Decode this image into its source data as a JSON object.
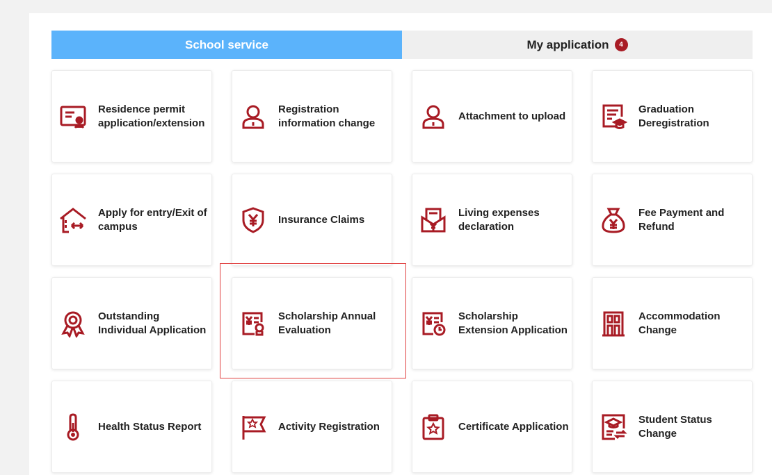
{
  "tabs": {
    "school_service": "School service",
    "my_application": "My application",
    "my_application_badge": "4"
  },
  "colors": {
    "accent": "#5bb3fb",
    "icon": "#a81b24",
    "highlight_border": "#e0403f"
  },
  "services": [
    {
      "label": "Residence permit application/extension",
      "icon": "id-card-icon"
    },
    {
      "label": "Registration information change",
      "icon": "user-icon"
    },
    {
      "label": "Attachment to upload",
      "icon": "user-upload-icon"
    },
    {
      "label": "Graduation Deregistration",
      "icon": "graduation-document-icon"
    },
    {
      "label": "Apply for entry/Exit of campus",
      "icon": "campus-gate-icon"
    },
    {
      "label": "Insurance Claims",
      "icon": "insurance-shield-icon"
    },
    {
      "label": "Living expenses declaration",
      "icon": "expense-envelope-icon"
    },
    {
      "label": "Fee Payment and Refund",
      "icon": "money-bag-icon"
    },
    {
      "label": "Outstanding Individual Application",
      "icon": "award-medal-icon"
    },
    {
      "label": "Scholarship Annual Evaluation",
      "icon": "scholarship-certificate-icon"
    },
    {
      "label": "Scholarship Extension Application",
      "icon": "scholarship-clock-icon"
    },
    {
      "label": "Accommodation Change",
      "icon": "building-icon"
    },
    {
      "label": "Health Status Report",
      "icon": "thermometer-icon"
    },
    {
      "label": "Activity Registration",
      "icon": "flag-star-icon"
    },
    {
      "label": "Certificate Application",
      "icon": "clipboard-star-icon"
    },
    {
      "label": "Student Status Change",
      "icon": "student-status-icon"
    }
  ]
}
